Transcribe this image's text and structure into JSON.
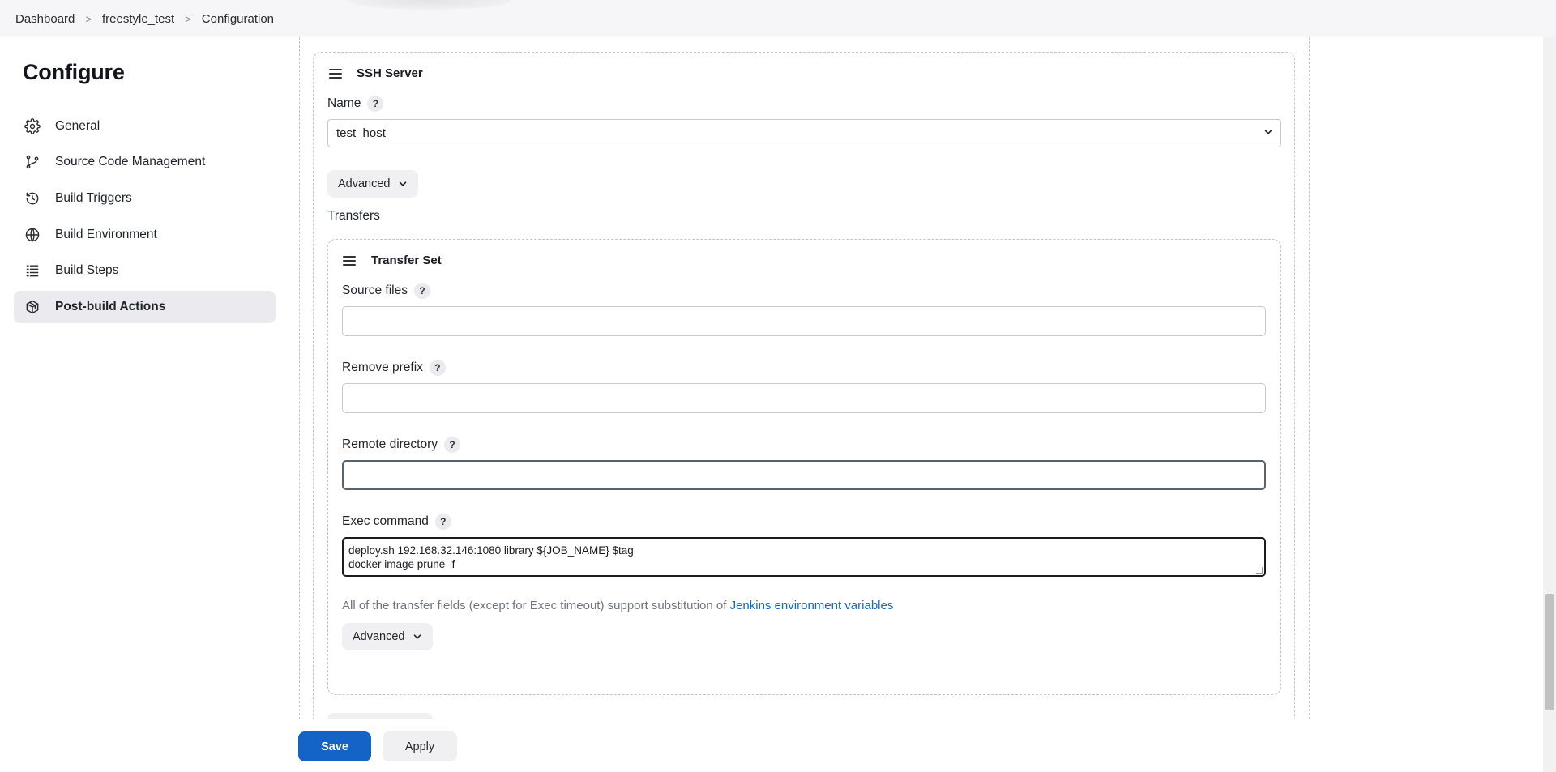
{
  "breadcrumb": {
    "items": [
      "Dashboard",
      "freestyle_test",
      "Configuration"
    ],
    "separator": ">"
  },
  "sidebar": {
    "title": "Configure",
    "items": [
      {
        "label": "General",
        "icon": "gear-icon"
      },
      {
        "label": "Source Code Management",
        "icon": "git-branch-icon"
      },
      {
        "label": "Build Triggers",
        "icon": "clock-icon"
      },
      {
        "label": "Build Environment",
        "icon": "globe-icon"
      },
      {
        "label": "Build Steps",
        "icon": "list-icon"
      },
      {
        "label": "Post-build Actions",
        "icon": "package-icon",
        "active": true
      }
    ]
  },
  "ssh_server": {
    "title": "SSH Server",
    "name_label": "Name",
    "name_value": "test_host",
    "advanced_label": "Advanced",
    "transfers_label": "Transfers"
  },
  "transfer_set": {
    "title": "Transfer Set",
    "source_files_label": "Source files",
    "source_files_value": "",
    "remove_prefix_label": "Remove prefix",
    "remove_prefix_value": "",
    "remote_directory_label": "Remote directory",
    "remote_directory_value": "",
    "exec_command_label": "Exec command",
    "exec_command_value": "deploy.sh 192.168.32.146:1080 library ${JOB_NAME} $tag\ndocker image prune -f",
    "note_text": "All of the transfer fields (except for Exec timeout) support substitution of ",
    "note_link": "Jenkins environment variables",
    "advanced_label": "Advanced"
  },
  "help_symbol": "?",
  "footer": {
    "save_label": "Save",
    "apply_label": "Apply"
  },
  "colors": {
    "primary": "#1463c7",
    "link": "#1268c9",
    "active_bg": "#ebebef"
  }
}
